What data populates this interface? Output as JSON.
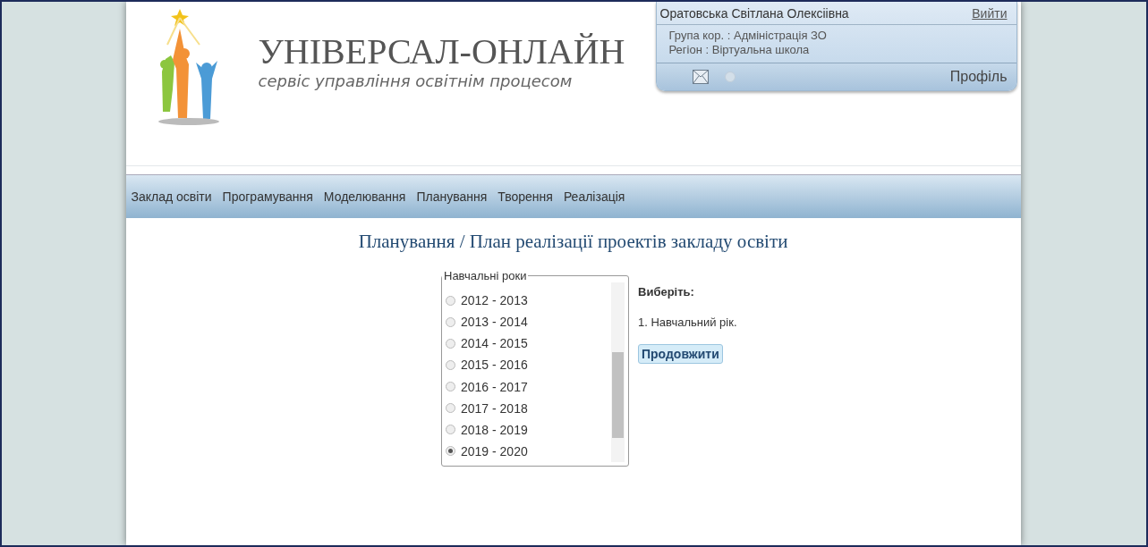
{
  "logo": {
    "title": "УНІВЕРСАЛ-ОНЛАЙН",
    "subtitle": "сервіс управління освітнім процесом"
  },
  "user_panel": {
    "name": "Оратовська Світлана Олексіівна",
    "logout": "Вийти",
    "group": "Група кор. : Адміністрація ЗО",
    "region": "Регіон : Віртуальна школа",
    "profile": "Профіль"
  },
  "menu": [
    "Заклад освіти",
    "Програмування",
    "Моделювання",
    "Планування",
    "Творення",
    "Реалізація"
  ],
  "page_title": "Планування / План реалізації проектів закладу освіти",
  "years": {
    "legend": "Навчальні роки",
    "items": [
      {
        "label": "2012 - 2013",
        "selected": false
      },
      {
        "label": "2013 - 2014",
        "selected": false
      },
      {
        "label": "2014 - 2015",
        "selected": false
      },
      {
        "label": "2015 - 2016",
        "selected": false
      },
      {
        "label": "2016 - 2017",
        "selected": false
      },
      {
        "label": "2017 - 2018",
        "selected": false
      },
      {
        "label": "2018 - 2019",
        "selected": false
      },
      {
        "label": "2019 - 2020",
        "selected": true
      }
    ]
  },
  "instructions": {
    "heading": "Виберіть:",
    "step": "1. Навчальний рік.",
    "button": "Продовжити"
  }
}
